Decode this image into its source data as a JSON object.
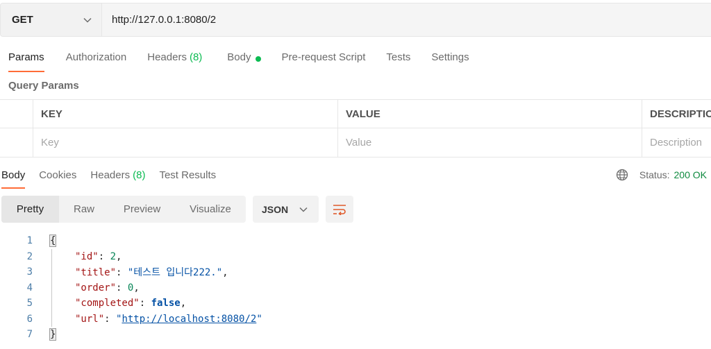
{
  "request": {
    "method": "GET",
    "url": "http://127.0.0.1:8080/2",
    "tabs": [
      {
        "label": "Params"
      },
      {
        "label": "Authorization"
      },
      {
        "label": "Headers",
        "count": "(8)"
      },
      {
        "label": "Body"
      },
      {
        "label": "Pre-request Script"
      },
      {
        "label": "Tests"
      },
      {
        "label": "Settings"
      }
    ]
  },
  "query_params": {
    "title": "Query Params",
    "headers": {
      "key": "KEY",
      "value": "VALUE",
      "description": "DESCRIPTIO"
    },
    "placeholders": {
      "key": "Key",
      "value": "Value",
      "description": "Description"
    }
  },
  "response": {
    "tabs": [
      {
        "label": "Body"
      },
      {
        "label": "Cookies"
      },
      {
        "label": "Headers",
        "count": "(8)"
      },
      {
        "label": "Test Results"
      }
    ],
    "status_label": "Status:",
    "status_value": "200 OK",
    "view_modes": [
      "Pretty",
      "Raw",
      "Preview",
      "Visualize"
    ],
    "format": "JSON",
    "code": {
      "line_numbers": [
        "1",
        "2",
        "3",
        "4",
        "5",
        "6",
        "7"
      ],
      "open_brace": "{",
      "close_brace": "}",
      "id_key": "\"id\"",
      "id_value": "2",
      "title_key": "\"title\"",
      "title_value": "\"테스트 입니다222.\"",
      "order_key": "\"order\"",
      "order_value": "0",
      "completed_key": "\"completed\"",
      "completed_value": "false",
      "url_key": "\"url\"",
      "url_value": "http://localhost:8080/2"
    }
  },
  "colors": {
    "accent": "#ff6c37",
    "success": "#0cbb52"
  }
}
